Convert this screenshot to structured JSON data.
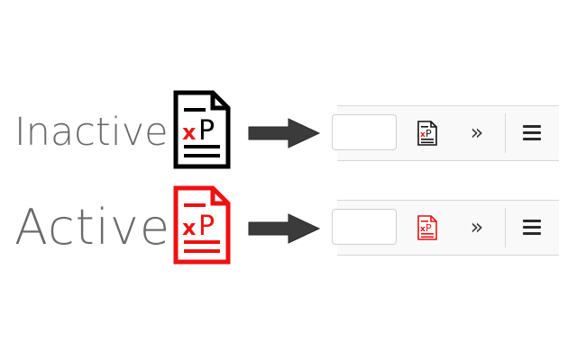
{
  "states": [
    {
      "label": "Inactive",
      "icon": "xpath-document-icon",
      "icon_color": "#000000",
      "icon_text_x": "x",
      "icon_text_p": "P",
      "x_color": "#e31b1b"
    },
    {
      "label": "Active",
      "icon": "xpath-document-icon",
      "icon_color": "#ee1111",
      "icon_text_x": "x",
      "icon_text_p": "P",
      "x_color": "#ee1111"
    }
  ],
  "arrow_icon": "right-arrow-icon",
  "toolbar": {
    "overflow_glyph": "»",
    "overflow_icon": "double-chevron-icon",
    "menu_icon": "hamburger-menu-icon",
    "background": "#f9f9fa"
  }
}
